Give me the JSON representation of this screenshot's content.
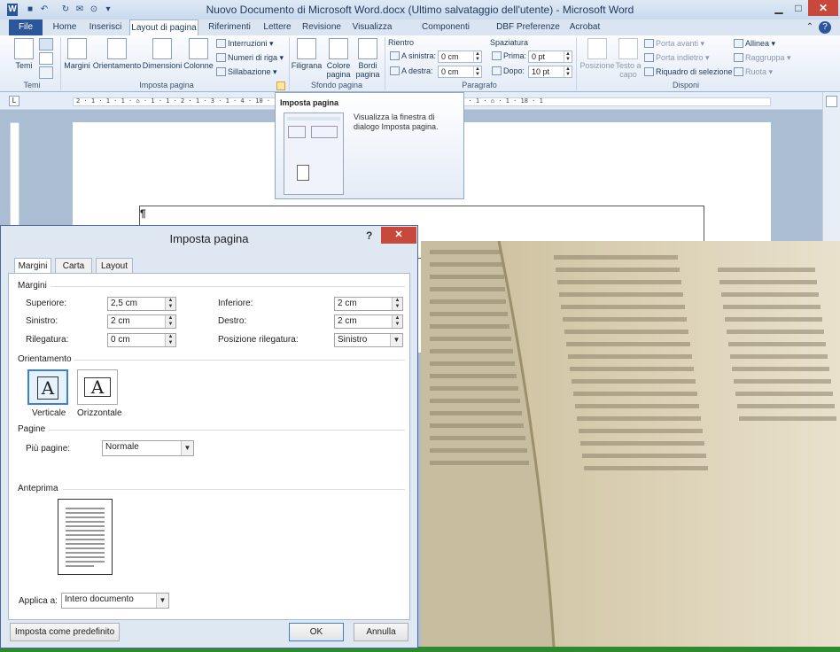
{
  "window": {
    "title": "Nuovo Documento di Microsoft Word.docx (Ultimo salvataggio dell'utente) - Microsoft Word",
    "qat": [
      "W",
      "■",
      "↶",
      "↻",
      "✉",
      "⊙",
      "▾"
    ],
    "minimize": "▁",
    "maximize": "□",
    "close": "✕",
    "help": "?",
    "collapse": "⌃"
  },
  "tabs": [
    "File",
    "Home",
    "Inserisci",
    "Layout di pagina",
    "Riferimenti",
    "Lettere",
    "Revisione",
    "Visualizza",
    "Componenti aggiuntivi",
    "DBF Preferenze",
    "Acrobat"
  ],
  "ribbon": {
    "temi": {
      "label": "Temi",
      "group": "Temi"
    },
    "imposta": {
      "group": "Imposta pagina",
      "margini": "Margini",
      "orientamento": "Orientamento",
      "dimensioni": "Dimensioni",
      "colonne": "Colonne",
      "interruzioni": "Interruzioni",
      "numeri_riga": "Numeri di riga",
      "sillabazione": "Sillabazione"
    },
    "sfondo": {
      "group": "Sfondo pagina",
      "filigrana": "Filigrana",
      "colore_1": "Colore",
      "colore_2": "pagina",
      "bordi_1": "Bordi",
      "bordi_2": "pagina"
    },
    "paragrafo": {
      "group": "Paragrafo",
      "rientro": "Rientro",
      "a_sinistra_label": "A sinistra:",
      "a_sinistra_value": "0 cm",
      "a_destra_label": "A destra:",
      "a_destra_value": "0 cm",
      "spaziatura": "Spaziatura",
      "prima_label": "Prima:",
      "prima_value": "0 pt",
      "dopo_label": "Dopo:",
      "dopo_value": "10 pt"
    },
    "disponi": {
      "group": "Disponi",
      "posizione": "Posizione",
      "testo_1": "Testo a",
      "testo_2": "capo",
      "porta_avanti": "Porta avanti",
      "porta_indietro": "Porta indietro",
      "riquadro": "Riquadro di selezione",
      "allinea": "Allinea",
      "raggruppa": "Raggruppa",
      "ruota": "Ruota"
    }
  },
  "ruler": {
    "text": "2 · 1 · 1 · 1 · ⌂ · 1 · 1 · 2 · 1 · 3 · 1 · 4 ·                       10 · 1 · 11 · 1 · 12 · 1 · 13 · 1 · 14 · 1 · 15 · 1 · 16 · 1 · ⌂ · 1 · 18 · 1"
  },
  "tooltip": {
    "title": "Imposta pagina",
    "description": "Visualizza la finestra di dialogo Imposta pagina."
  },
  "document": {
    "pilcrow": "¶"
  },
  "dialog": {
    "title": "Imposta pagina",
    "tabs": [
      "Margini",
      "Carta",
      "Layout"
    ],
    "section_margini": "Margini",
    "superiore_label": "Superiore:",
    "superiore_value": "2,5 cm",
    "inferiore_label": "Inferiore:",
    "inferiore_value": "2 cm",
    "sinistro_label": "Sinistro:",
    "sinistro_value": "2 cm",
    "destro_label": "Destro:",
    "destro_value": "2 cm",
    "rilegatura_label": "Rilegatura:",
    "rilegatura_value": "0 cm",
    "pos_rilegatura_label": "Posizione rilegatura:",
    "pos_rilegatura_value": "Sinistro",
    "section_orientamento": "Orientamento",
    "verticale": "Verticale",
    "orizzontale": "Orizzontale",
    "orient_glyph": "A",
    "section_pagine": "Pagine",
    "piu_pagine_label": "Più pagine:",
    "piu_pagine_value": "Normale",
    "section_anteprima": "Anteprima",
    "applica_label": "Applica a:",
    "applica_value": "Intero documento",
    "btn_default": "Imposta come predefinito",
    "btn_ok": "OK",
    "btn_annulla": "Annulla"
  },
  "colors": {
    "accent": "#2b579a",
    "close": "#c9483c",
    "ribbon_bg": "#dbe5f1",
    "photo": "#d2c7a8",
    "green": "#2e8a2e"
  }
}
